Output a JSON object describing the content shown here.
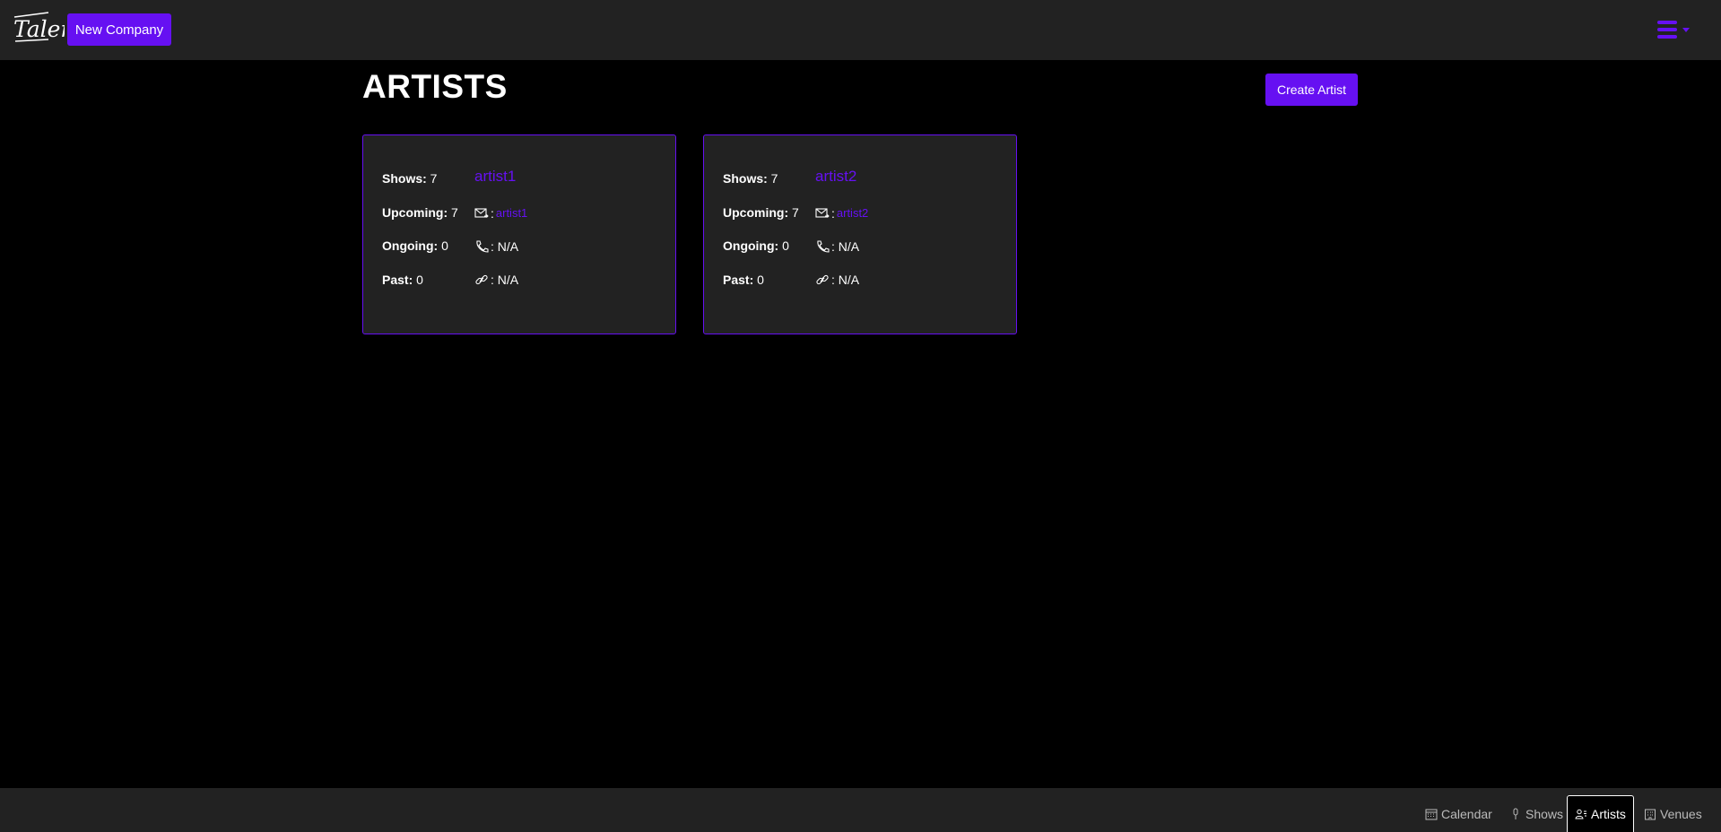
{
  "header": {
    "logo_text": "Talent",
    "new_company_label": "New Company",
    "menu_icon": "hamburger-icon"
  },
  "main": {
    "title": "ARTISTS",
    "create_label": "Create Artist",
    "artists": [
      {
        "name": "artist1",
        "email": "artist1",
        "phone": ": N/A",
        "link": ": N/A",
        "stats": {
          "shows_label": "Shows:",
          "shows": " 7",
          "upcoming_label": "Upcoming:",
          "upcoming": " 7",
          "ongoing_label": "Ongoing:",
          "ongoing": " 0",
          "past_label": "Past:",
          "past": " 0"
        }
      },
      {
        "name": "artist2",
        "email": "artist2",
        "phone": ": N/A",
        "link": ": N/A",
        "stats": {
          "shows_label": "Shows:",
          "shows": " 7",
          "upcoming_label": "Upcoming:",
          "upcoming": " 7",
          "ongoing_label": "Ongoing:",
          "ongoing": " 0",
          "past_label": "Past:",
          "past": " 0"
        }
      }
    ]
  },
  "bottom_nav": {
    "tabs": [
      {
        "label": "Calendar",
        "icon": "calendar-icon"
      },
      {
        "label": "Shows",
        "icon": "microphone-icon"
      },
      {
        "label": "Artists",
        "icon": "person-lines-icon",
        "active": true
      },
      {
        "label": "Venues",
        "icon": "building-icon"
      }
    ]
  },
  "colors": {
    "accent": "#6610f2",
    "bar": "#222222",
    "background": "#000000"
  }
}
